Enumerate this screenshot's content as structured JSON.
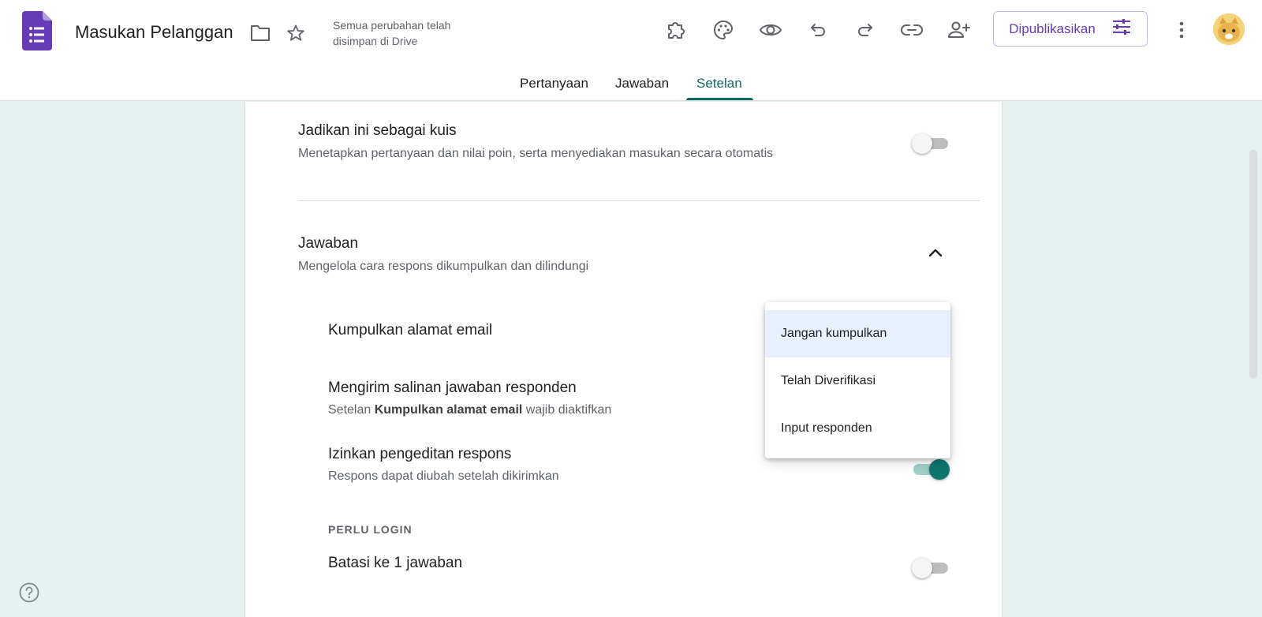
{
  "header": {
    "title": "Masukan Pelanggan",
    "save_status_line1": "Semua perubahan telah",
    "save_status_line2": "disimpan di Drive",
    "publish_label": "Dipublikasikan"
  },
  "tabs": {
    "questions": "Pertanyaan",
    "responses": "Jawaban",
    "settings": "Setelan",
    "active": "settings"
  },
  "settings": {
    "quiz": {
      "title": "Jadikan ini sebagai kuis",
      "desc": "Menetapkan pertanyaan dan nilai poin, serta menyediakan masukan secara otomatis",
      "enabled": false
    },
    "responses_section": {
      "title": "Jawaban",
      "desc": "Mengelola cara respons dikumpulkan dan dilindungi",
      "expanded": true
    },
    "collect_email": {
      "title": "Kumpulkan alamat email"
    },
    "send_copy": {
      "title": "Mengirim salinan jawaban responden",
      "desc_prefix": "Setelan",
      "desc_bold": "Kumpulkan alamat email",
      "desc_suffix": "wajib diaktifkan"
    },
    "allow_edit": {
      "title": "Izinkan pengeditan respons",
      "desc": "Respons dapat diubah setelah dikirimkan",
      "enabled": true
    },
    "login_section_label": "PERLU LOGIN",
    "limit_one": {
      "title": "Batasi ke 1 jawaban",
      "enabled": false
    }
  },
  "email_menu": {
    "options": [
      "Jangan kumpulkan",
      "Telah Diverifikasi",
      "Input responden"
    ],
    "selected": "Jangan kumpulkan"
  },
  "colors": {
    "forms_purple": "#673ab7",
    "accent_teal": "#10695e",
    "background": "#e6f2ef"
  },
  "icons": {
    "folder": "folder-icon",
    "star": "star-icon",
    "addons": "puzzle-icon",
    "theme": "palette-icon",
    "preview": "eye-icon",
    "undo": "undo-icon",
    "redo": "redo-icon",
    "link": "link-icon",
    "collaborators": "person-add-icon",
    "more": "more-vert-icon",
    "help": "help-icon"
  }
}
